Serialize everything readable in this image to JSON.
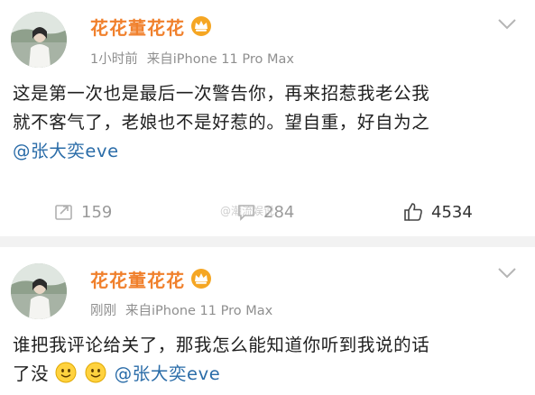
{
  "post1": {
    "username": "花花董花花",
    "time": "1小时前",
    "source": "来自iPhone 11 Pro Max",
    "lines": [
      "这是第一次也是最后一次警告你，再来招惹我老公我",
      "就不客气了，老娘也不是好惹的。望自重，好自为之"
    ],
    "mention": "@张大奕eve",
    "actions": {
      "repost_count": "159",
      "comment_count": "284",
      "like_count": "4534"
    },
    "watermark": "@潮流娱说"
  },
  "post2": {
    "username": "花花董花花",
    "time": "刚刚",
    "source": "来自iPhone 11 Pro Max",
    "lines": [
      "谁把我评论给关了，那我怎么能知道你听到我说的话"
    ],
    "line2_prefix": "了没",
    "mention": "@张大奕eve"
  },
  "icons": {
    "vip": "crown-badge-icon",
    "chevron": "chevron-down-icon",
    "repost": "repost-icon",
    "comment": "comment-icon",
    "like": "thumbs-up-icon",
    "emoji": "smile-emoji-icon"
  },
  "colors": {
    "username": "#f0802c",
    "mention": "#2a6ca8",
    "meta": "#8f8f8f"
  }
}
